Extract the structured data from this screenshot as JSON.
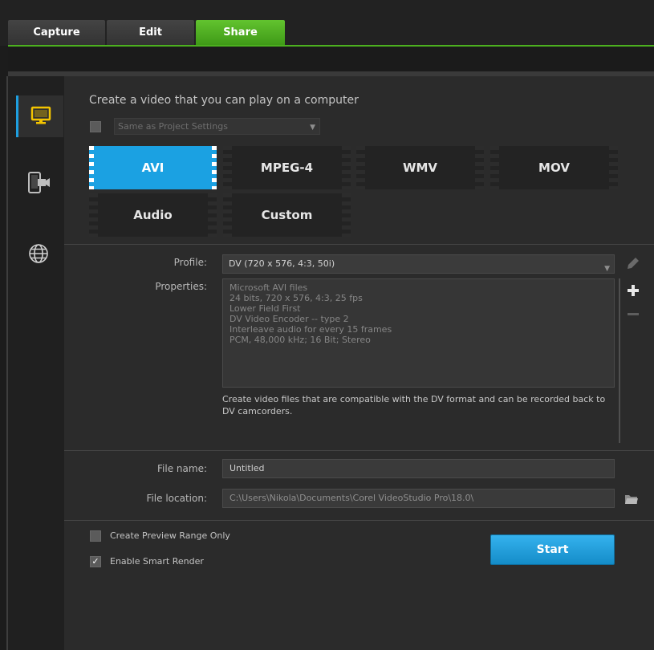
{
  "tabs": [
    {
      "label": "Capture",
      "active": false
    },
    {
      "label": "Edit",
      "active": false
    },
    {
      "label": "Share",
      "active": true
    }
  ],
  "sidebar": {
    "items": [
      {
        "icon": "computer-icon",
        "selected": true
      },
      {
        "icon": "mobile-device-icon",
        "selected": false
      },
      {
        "icon": "web-globe-icon",
        "selected": false
      }
    ]
  },
  "header": {
    "title": "Create a video that you can play on a computer",
    "same_as_project_checked": false,
    "same_as_project_label": "Same as Project Settings"
  },
  "formats": [
    {
      "label": "AVI",
      "selected": true
    },
    {
      "label": "MPEG-4",
      "selected": false
    },
    {
      "label": "WMV",
      "selected": false
    },
    {
      "label": "MOV",
      "selected": false
    },
    {
      "label": "Audio",
      "selected": false
    },
    {
      "label": "Custom",
      "selected": false
    }
  ],
  "profile": {
    "label": "Profile:",
    "value": "DV (720 x 576, 4:3, 50i)",
    "properties_label": "Properties:",
    "properties": [
      "Microsoft AVI files",
      "24 bits, 720 x 576, 4:3, 25 fps",
      "Lower Field First",
      "DV Video Encoder -- type 2",
      "Interleave audio for every 15 frames",
      "PCM, 48,000 kHz; 16 Bit; Stereo"
    ],
    "description": "Create video files that are compatible with the DV format and can be recorded back to DV camcorders."
  },
  "file": {
    "name_label": "File name:",
    "name_value": "Untitled",
    "location_label": "File location:",
    "location_value": "C:\\Users\\Nikola\\Documents\\Corel VideoStudio Pro\\18.0\\"
  },
  "options": {
    "preview_range_label": "Create Preview Range Only",
    "preview_range_checked": false,
    "smart_render_label": "Enable Smart Render",
    "smart_render_checked": true
  },
  "start_label": "Start",
  "colors": {
    "accent_blue": "#1ba1e2",
    "share_green": "#4cb01f"
  }
}
